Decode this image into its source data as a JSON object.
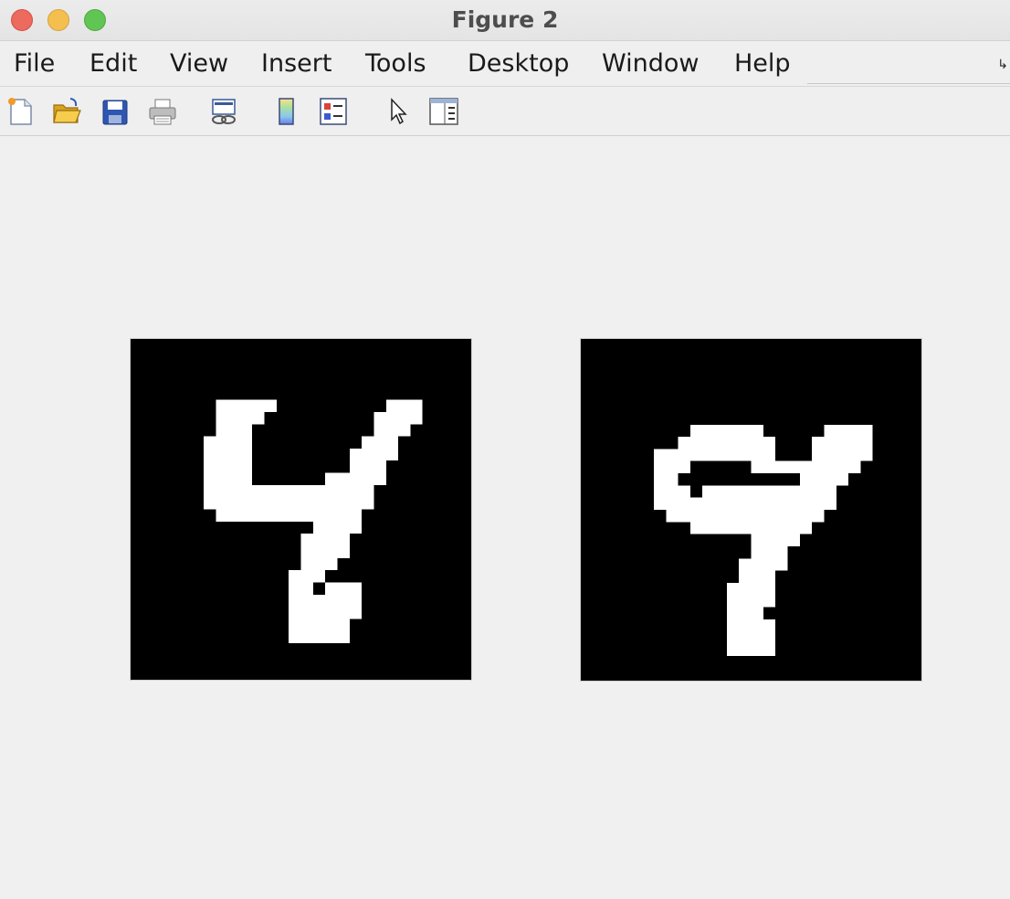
{
  "window": {
    "title": "Figure 2"
  },
  "menu": {
    "items": [
      "File",
      "Edit",
      "View",
      "Insert",
      "Tools",
      "Desktop",
      "Window",
      "Help"
    ]
  },
  "toolbar": {
    "buttons": [
      {
        "name": "new-figure-icon"
      },
      {
        "name": "open-file-icon"
      },
      {
        "name": "save-figure-icon"
      },
      {
        "name": "print-figure-icon"
      },
      {
        "name": "link-plot-icon"
      },
      {
        "name": "insert-colorbar-icon"
      },
      {
        "name": "insert-legend-icon"
      },
      {
        "name": "edit-plot-pointer-icon"
      },
      {
        "name": "property-inspector-icon"
      }
    ]
  },
  "images": [
    {
      "name": "digit-image-1",
      "grid_size": 28,
      "colors": {
        "background": "#000000",
        "foreground": "#ffffff"
      },
      "description_digit": "4"
    },
    {
      "name": "digit-image-2",
      "grid_size": 28,
      "colors": {
        "background": "#000000",
        "foreground": "#ffffff"
      },
      "description_digit": "9"
    }
  ]
}
